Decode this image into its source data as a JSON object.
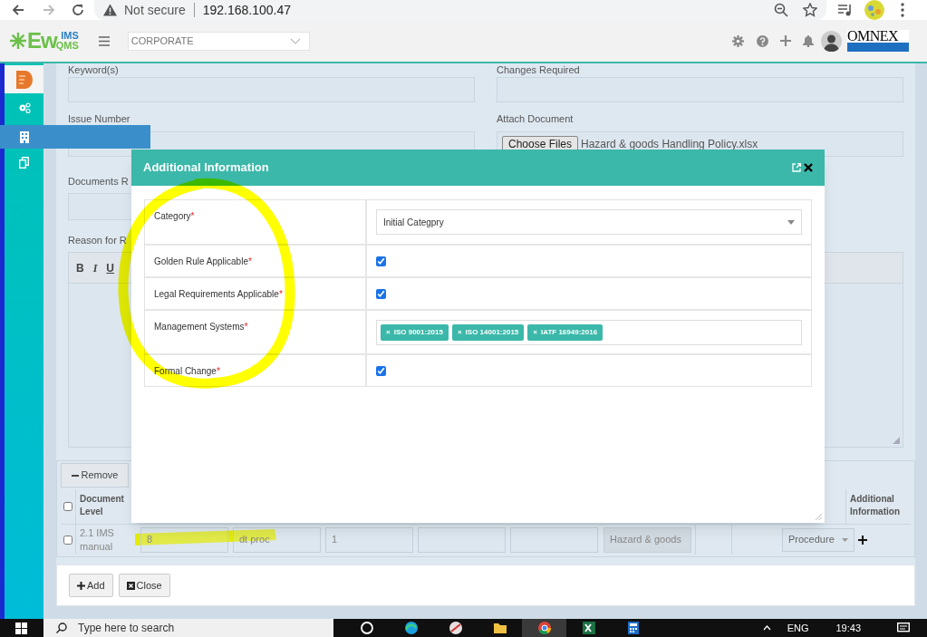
{
  "browser": {
    "security": "Not secure",
    "url": "192.168.100.47"
  },
  "header": {
    "logo": {
      "main": "Ew",
      "top": "IMS",
      "bottom": "QMS"
    },
    "site_select": "CORPORATE",
    "brand": "OMNEX"
  },
  "sidebar": {
    "items": [
      {
        "selected": true,
        "hovered": false
      },
      {
        "selected": false,
        "hovered": false
      },
      {
        "selected": false,
        "hovered": true
      },
      {
        "selected": false,
        "hovered": false
      }
    ]
  },
  "form": {
    "keywords_label": "Keyword(s)",
    "changes_label": "Changes Required",
    "issue_label": "Issue Number",
    "attach_label": "Attach Document",
    "choose_button": "Choose Files",
    "file_name": "Hazard & goods Handling Policy.xlsx",
    "documents_label": "Documents R",
    "reason_label": "Reason for R",
    "editor_tools": [
      "B",
      "I",
      "U"
    ]
  },
  "documents_table": {
    "remove_button": "Remove",
    "select_all_checked": false,
    "columns": [
      "Document Level",
      "Additional Information"
    ],
    "rows": [
      {
        "checked": false,
        "level": "2.1 IMS manual",
        "cells": [
          {
            "kind": "input",
            "value": "8"
          },
          {
            "kind": "input",
            "value": "dt proc"
          },
          {
            "kind": "input",
            "value": "1"
          },
          {
            "kind": "input"
          },
          {
            "kind": "input"
          },
          {
            "kind": "chip",
            "value": "Hazard & goods"
          },
          {
            "kind": "blank"
          },
          {
            "kind": "blank"
          },
          {
            "kind": "select",
            "value": "Procedure"
          },
          {
            "kind": "add"
          }
        ]
      }
    ]
  },
  "footer": {
    "buttons": [
      "Add",
      "Close"
    ]
  },
  "modal": {
    "title": "Additional Information",
    "rows": [
      {
        "label": "Category",
        "required_mark": "*",
        "kind": "select",
        "value": "Initial Categpry"
      },
      {
        "label": "Golden Rule Applicable",
        "required_mark": "*",
        "kind": "checkbox",
        "checked": true
      },
      {
        "label": "Legal Requirements Applicable",
        "required_mark": "*",
        "kind": "checkbox",
        "checked": true
      },
      {
        "label": "Management Systems",
        "required_mark": "*",
        "kind": "tags",
        "tags": [
          {
            "remove": "×",
            "label": "ISO 9001:2015"
          },
          {
            "remove": "×",
            "label": "ISO 14001:2015"
          },
          {
            "remove": "×",
            "label": "IATF 16949:2016"
          }
        ]
      },
      {
        "label": "Formal Change",
        "required_mark": "*",
        "kind": "checkbox",
        "checked": true
      }
    ]
  },
  "taskbar": {
    "search_placeholder": "Type here to search",
    "language": "ENG",
    "time": "19:43"
  }
}
